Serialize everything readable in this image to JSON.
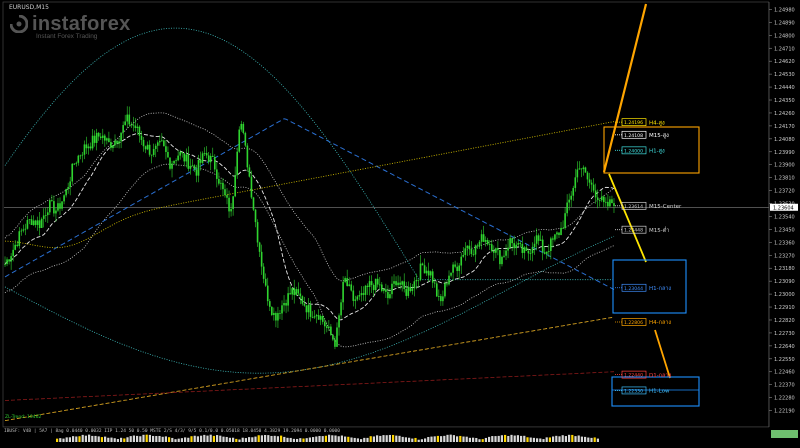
{
  "symbol_title": "EURUSD,M15",
  "logo": {
    "brand": "instaforex",
    "tagline": "Instant Forex Trading"
  },
  "colors": {
    "background": "#000000",
    "candles": "#2fd52f",
    "price_line": "#808080",
    "orange": "#ffa500",
    "yellow": "#ffe600",
    "blue_box": "#1e90ff",
    "h4_ma": "#c8b400",
    "d1_ma": "#d4a020",
    "w1_ma": "#8b1a1a",
    "h1_ma": "#2a6fd1",
    "cyan_env": "#40c0c0",
    "white_env": "#cfcfcf"
  },
  "chart_data": {
    "type": "candlestick",
    "instrument": "EURUSD",
    "timeframe": "M15",
    "current_price": "1.23604",
    "price_axis": {
      "ylim": [
        1.2218,
        1.2499
      ],
      "ticks": [
        "1.24980",
        "1.24890",
        "1.24800",
        "1.24710",
        "1.24620",
        "1.24530",
        "1.24440",
        "1.24350",
        "1.24260",
        "1.24170",
        "1.24080",
        "1.23990",
        "1.23900",
        "1.23810",
        "1.23720",
        "1.23630",
        "1.23540",
        "1.23450",
        "1.23360",
        "1.23270",
        "1.23180",
        "1.23090",
        "1.23000",
        "1.22910",
        "1.22820",
        "1.22730",
        "1.22640",
        "1.22550",
        "1.22460",
        "1.22370",
        "1.22280",
        "1.22190"
      ]
    },
    "price_path": [
      1.2321,
      1.2332,
      1.2345,
      1.2352,
      1.2349,
      1.2362,
      1.2358,
      1.2371,
      1.2392,
      1.2401,
      1.2406,
      1.2411,
      1.2404,
      1.2409,
      1.2421,
      1.2416,
      1.2404,
      1.2398,
      1.2404,
      1.2391,
      1.2398,
      1.2392,
      1.2386,
      1.2398,
      1.2391,
      1.2372,
      1.2356,
      1.2424,
      1.2386,
      1.2341,
      1.2302,
      1.2284,
      1.2294,
      1.2302,
      1.2297,
      1.2288,
      1.2287,
      1.2276,
      1.2266,
      1.2311,
      1.2296,
      1.2297,
      1.2307,
      1.2306,
      1.2297,
      1.2311,
      1.2301,
      1.2308,
      1.232,
      1.2314,
      1.2292,
      1.2314,
      1.232,
      1.2334,
      1.2331,
      1.234,
      1.2334,
      1.2324,
      1.2337,
      1.2332,
      1.2327,
      1.234,
      1.2329,
      1.2337,
      1.2346,
      1.2368,
      1.2391,
      1.2379,
      1.237,
      1.236,
      1.2365
    ],
    "levels": [
      {
        "label": "H4-สูง",
        "price": "1.24196",
        "color": "#ffe600"
      },
      {
        "label": "M15-สูง",
        "price": "1.24108",
        "color": "#ffffff"
      },
      {
        "label": "H1-สูง",
        "price": "1.24000",
        "color": "#40e0e0"
      },
      {
        "label": "M15-Center",
        "price": "1.23614",
        "color": "#cfcfcf"
      },
      {
        "label": "M15-ต่ำ",
        "price": "1.23448",
        "color": "#cfcfcf"
      },
      {
        "label": "H1-กลาง",
        "price": "1.23044",
        "color": "#4090ff"
      },
      {
        "label": "H4-กลาง",
        "price": "1.22806",
        "color": "#ffa500"
      },
      {
        "label": "D1-กลาง",
        "price": "1.22440",
        "color": "#ff4040"
      },
      {
        "label": "H1-Low",
        "price": "1.22330",
        "color": "#40c0ff"
      }
    ],
    "indicator_label": "ZL-Trend: 10462",
    "bottom_info": "IBUSF: V4B | 5A7 | 8ag 0.0440 0.0032 IIP 1.24 50 0.50 MSTE 2/S 4/3/ 9/5 0.1/0.0 0.05018 18.0450 4.3829 19.2094 0.0000 0.0000"
  }
}
